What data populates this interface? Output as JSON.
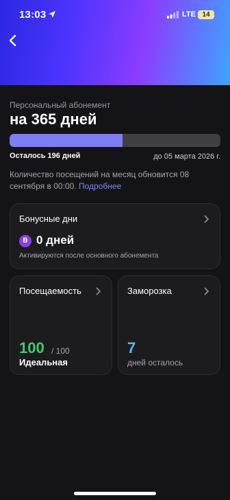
{
  "status_bar": {
    "time": "13:03",
    "network": "LTE",
    "battery": "14"
  },
  "header": {
    "back_icon": "chevron-left-icon",
    "gradient": [
      "#2b28e0",
      "#4b34ff",
      "#8b3dff",
      "#3ea4ff"
    ]
  },
  "subscription": {
    "label": "Персональный абонемент",
    "title": "на 365 дней",
    "progress_fraction": 0.537,
    "remaining": "Осталось 196 дней",
    "until": "до 05 марта 2026 г.",
    "notice": "Количество посещений на месяц обновится 08 сентября в 00:00.",
    "more_link": "Подробнее"
  },
  "bonus_card": {
    "title": "Бонусные дни",
    "badge": "B",
    "value": "0 дней",
    "note": "Активируются после основного абонемента"
  },
  "attendance_card": {
    "title": "Посещаемость",
    "value": "100",
    "of": "/ 100",
    "status": "Идеальная"
  },
  "freeze_card": {
    "title": "Заморозка",
    "value": "7",
    "label": "дней осталось"
  },
  "colors": {
    "background": "#141416",
    "card": "#1c1c1f",
    "progress_fill": "#7d7df7",
    "attendance_green": "#3ecb6a",
    "freeze_blue": "#5fb4f0",
    "link": "#7b86ff",
    "badge_purple": "#8a40e8"
  }
}
